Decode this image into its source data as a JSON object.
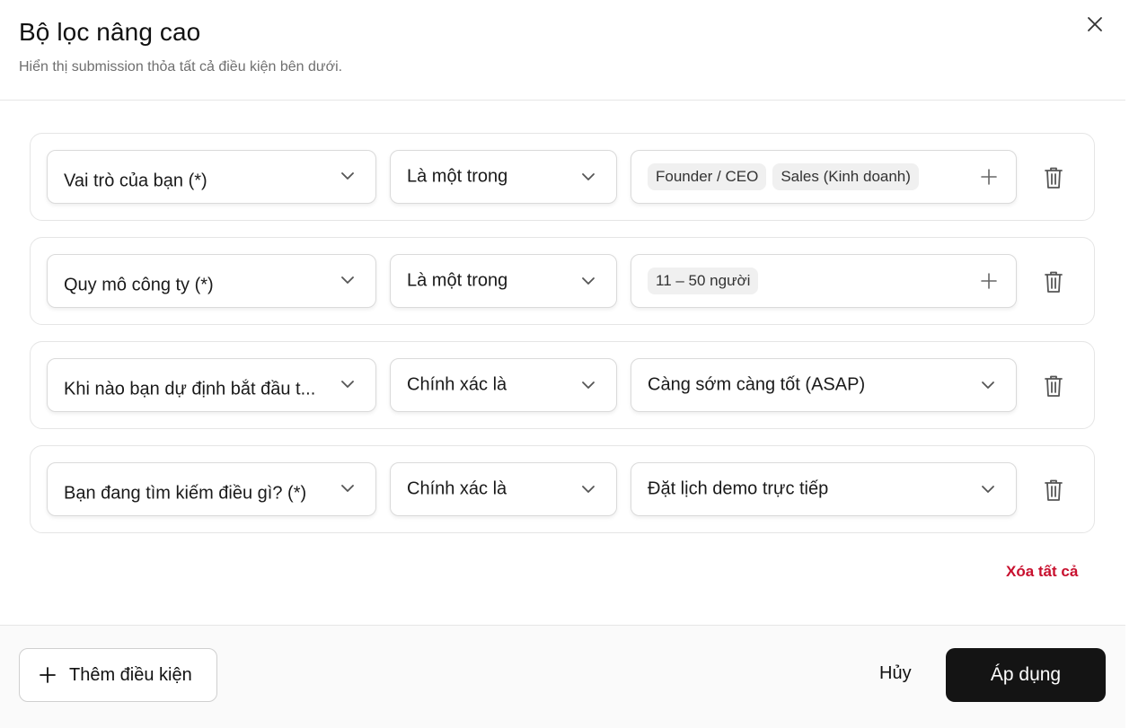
{
  "dialog": {
    "title": "Bộ lọc nâng cao",
    "subtitle": "Hiển thị submission thỏa tất cả điều kiện bên dưới."
  },
  "rules": [
    {
      "field": "Vai trò của bạn (*)",
      "operator": "Là một trong",
      "value_type": "tags",
      "tags": [
        "Founder / CEO",
        "Sales (Kinh doanh)"
      ]
    },
    {
      "field": "Quy mô công ty (*)",
      "operator": "Là một trong",
      "value_type": "tags",
      "tags": [
        "11 – 50 người"
      ]
    },
    {
      "field": "Khi nào bạn dự định bắt đầu t...",
      "operator": "Chính xác là",
      "value_type": "select",
      "value": "Càng sớm càng tốt (ASAP)"
    },
    {
      "field": "Bạn đang tìm kiếm điều gì? (*)",
      "operator": "Chính xác là",
      "value_type": "select",
      "value": "Đặt lịch demo trực tiếp"
    }
  ],
  "actions": {
    "clear_all": "Xóa tất cả",
    "add_condition": "Thêm điều kiện",
    "cancel": "Hủy",
    "apply": "Áp dụng"
  },
  "icons": {
    "close": "close-icon",
    "chevron": "chevron-down-icon",
    "add": "plus-icon",
    "delete": "trash-icon"
  },
  "colors": {
    "danger": "#c8102e",
    "primary_button": "#141414"
  }
}
